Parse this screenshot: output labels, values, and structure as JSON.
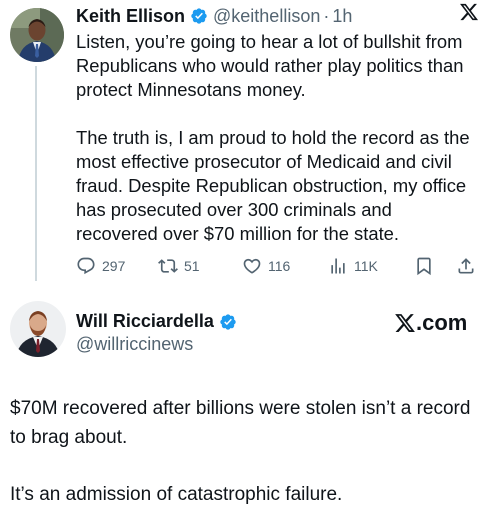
{
  "tweet1": {
    "author_name": "Keith Ellison",
    "handle": "@keithellison",
    "separator": "·",
    "time": "1h",
    "paragraphs": [
      "Listen, you’re going to hear a lot of bullshit from Republicans who would rather play politics than protect Minnesotans money.",
      "The truth is, I am proud to hold the record as the most effective prosecutor of Medicaid and civil fraud. Despite Republican obstruction, my office has prosecuted over 300 criminals and recovered over $70 million for the state."
    ],
    "actions": {
      "replies": "297",
      "reposts": "51",
      "likes": "116",
      "views": "11K"
    },
    "icons": [
      "reply-icon",
      "repost-icon",
      "like-icon",
      "views-icon",
      "bookmark-icon",
      "share-icon",
      "x-logo-icon"
    ]
  },
  "tweet2": {
    "author_name": "Will Ricciardella",
    "handle": "@willriccinews",
    "watermark": ".com",
    "paragraphs": [
      "$70M recovered after billions were stolen isn’t a record to brag about.",
      "It’s an admission of catastrophic failure."
    ]
  },
  "colors": {
    "text": "#0f1419",
    "secondary": "#536471",
    "verified_blue": "#1d9bf0",
    "thread_line": "#cfd9de"
  }
}
